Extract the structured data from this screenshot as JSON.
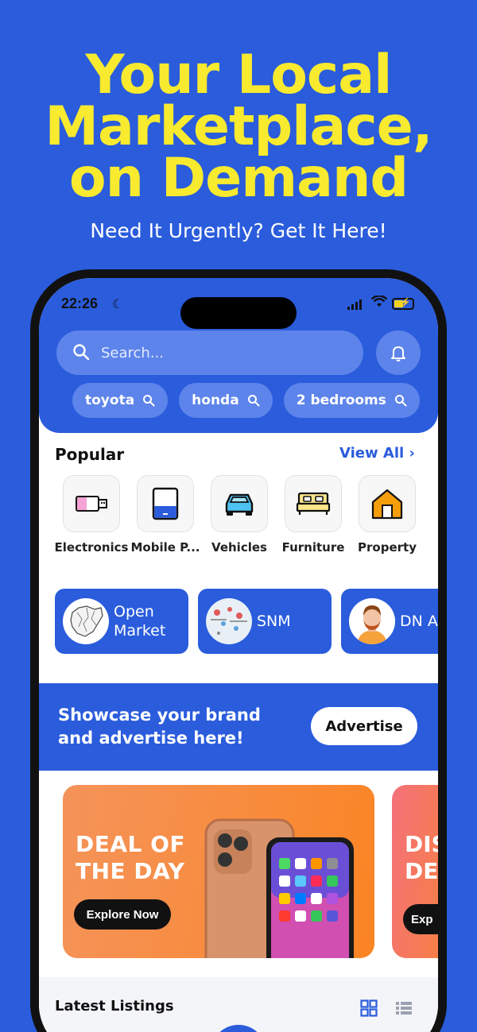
{
  "headline": {
    "line1": "Your Local",
    "line2": "Marketplace,",
    "line3": "on Demand",
    "subtitle": "Need It Urgently? Get It Here!"
  },
  "status_bar": {
    "time": "22:26"
  },
  "search": {
    "placeholder": "Search..."
  },
  "chips": [
    {
      "label": "toyota"
    },
    {
      "label": "honda"
    },
    {
      "label": "2 bedrooms"
    }
  ],
  "popular": {
    "title": "Popular",
    "view_all": "View All",
    "categories": [
      {
        "label": "Electronics",
        "icon": "usb-drive-icon"
      },
      {
        "label": "Mobile P...",
        "icon": "mobile-phone-icon"
      },
      {
        "label": "Vehicles",
        "icon": "car-icon"
      },
      {
        "label": "Furniture",
        "icon": "bed-icon"
      },
      {
        "label": "Property",
        "icon": "house-icon"
      }
    ]
  },
  "stores": [
    {
      "name_line1": "Open",
      "name_line2": "Market"
    },
    {
      "name_line1": "SNM",
      "name_line2": ""
    },
    {
      "name_line1": "DN Ag",
      "name_line2": ""
    }
  ],
  "promo": {
    "line1": "Showcase your brand",
    "line2": "and advertise here!",
    "button": "Advertise"
  },
  "banners": [
    {
      "line1": "DEAL OF",
      "line2": "THE DAY",
      "button": "Explore Now"
    },
    {
      "line1": "DIS",
      "line2": "DE",
      "button": "Exp"
    }
  ],
  "latest": {
    "title": "Latest Listings"
  },
  "colors": {
    "brand_blue": "#2a5cdc",
    "headline_yellow": "#f7ea2f",
    "banner_orange": "#f88c3e"
  }
}
